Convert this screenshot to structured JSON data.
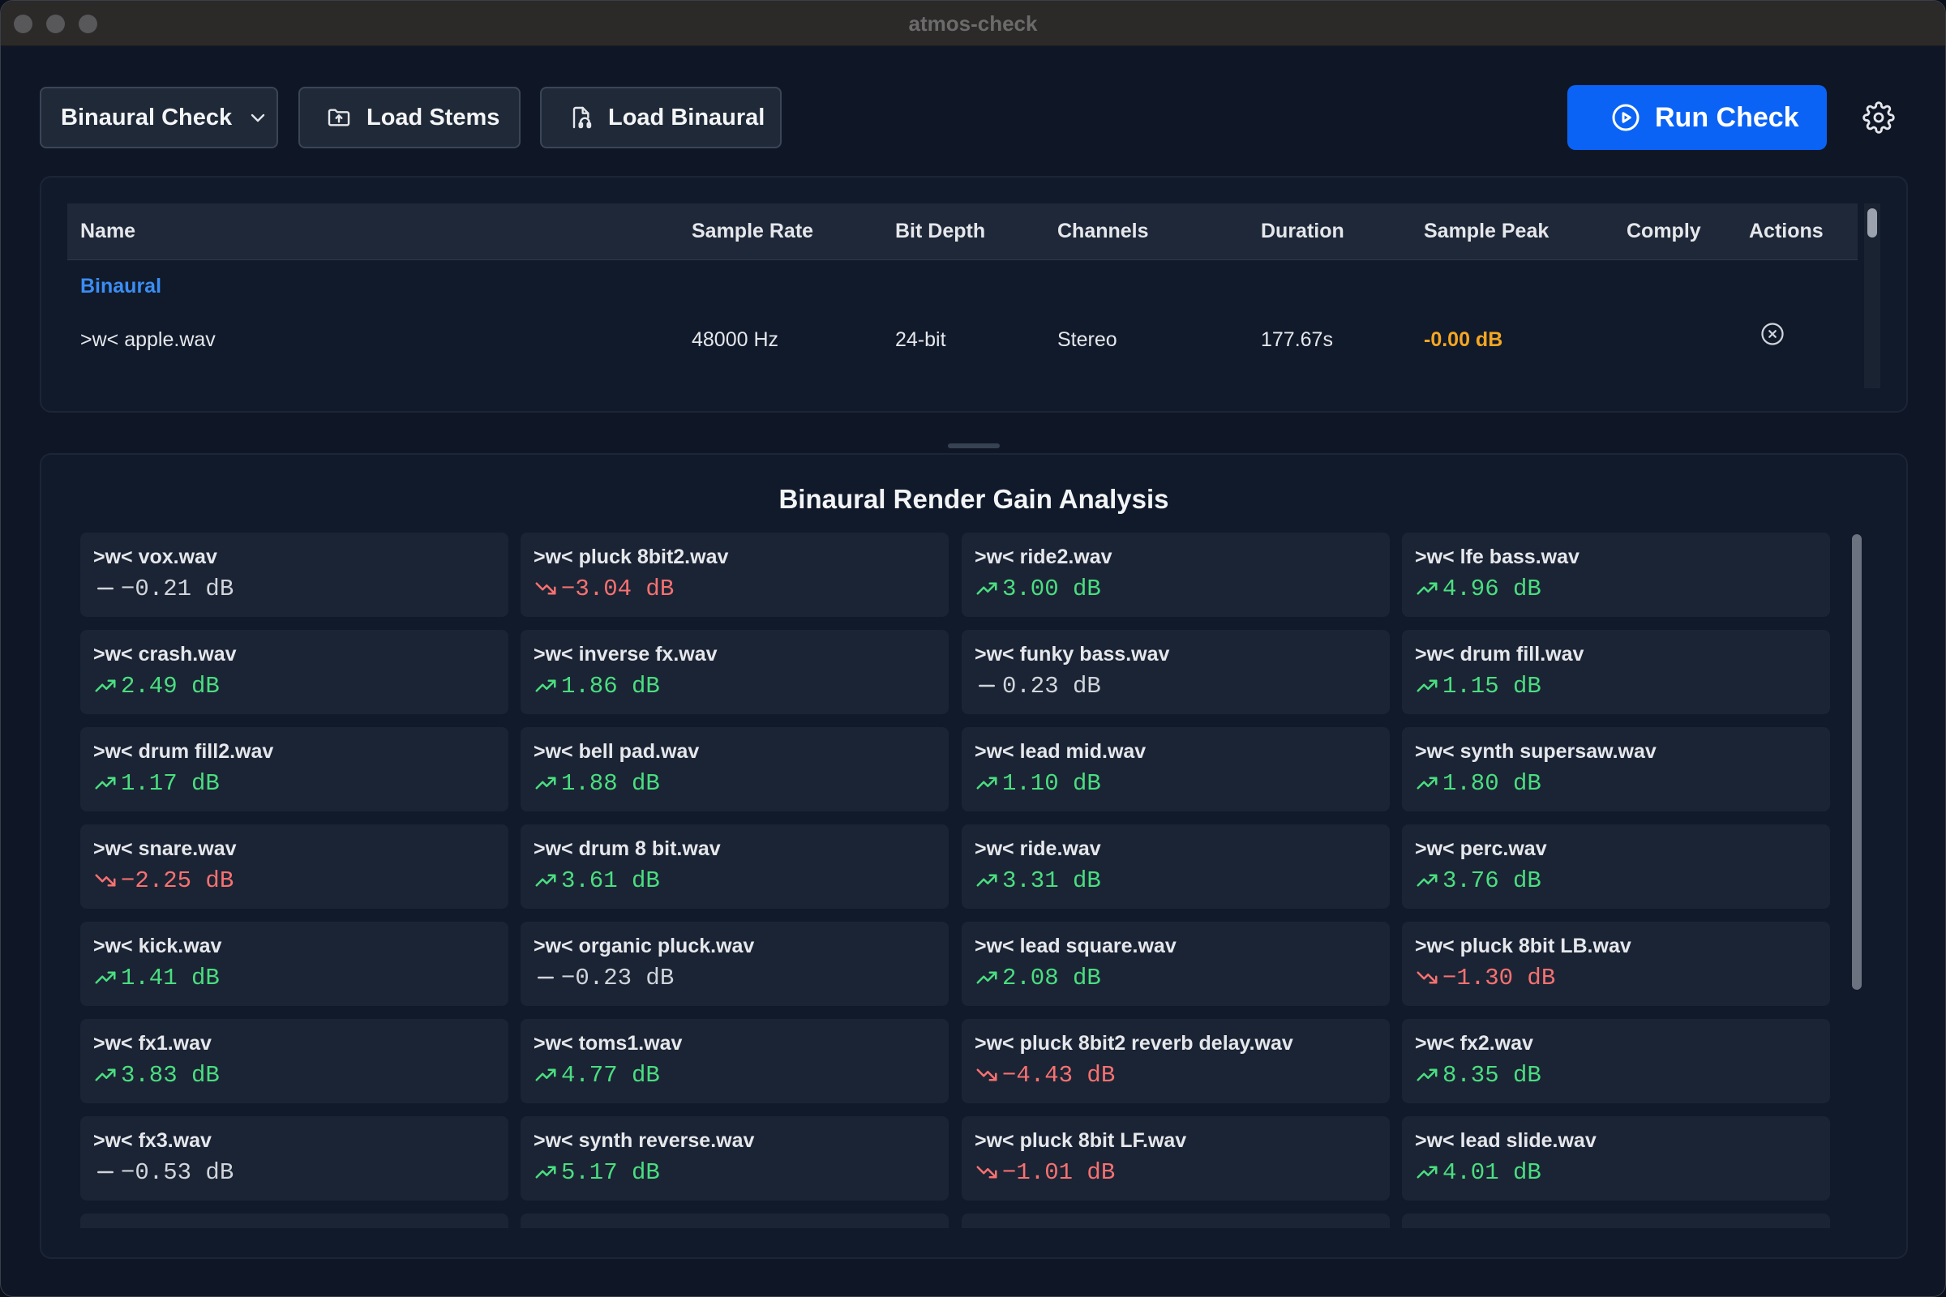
{
  "window": {
    "title": "atmos-check"
  },
  "toolbar": {
    "mode_label": "Binaural Check",
    "load_stems_label": "Load Stems",
    "load_binaural_label": "Load Binaural",
    "run_label": "Run Check",
    "run_color": "#0b63f5"
  },
  "files": {
    "headers": {
      "name": "Name",
      "sample_rate": "Sample Rate",
      "bit_depth": "Bit Depth",
      "channels": "Channels",
      "duration": "Duration",
      "sample_peak": "Sample Peak",
      "comply": "Comply",
      "actions": "Actions"
    },
    "group": "Binaural",
    "row": {
      "name": ">w< apple.wav",
      "sample_rate": "48000 Hz",
      "bit_depth": "24-bit",
      "channels": "Stereo",
      "duration": "177.67s",
      "sample_peak": "-0.00 dB",
      "comply": "",
      "action_icon": "close-circle-icon"
    }
  },
  "analysis": {
    "title": "Binaural Render Gain Analysis",
    "colors": {
      "up": "#4ade80",
      "down": "#f87171",
      "flat": "#d1d5db"
    },
    "items": [
      {
        "name": ">w< vox.wav",
        "value": "−0.21 dB",
        "trend": "flat"
      },
      {
        "name": ">w< pluck 8bit2.wav",
        "value": "−3.04 dB",
        "trend": "down"
      },
      {
        "name": ">w< ride2.wav",
        "value": "3.00 dB",
        "trend": "up"
      },
      {
        "name": ">w< lfe bass.wav",
        "value": "4.96 dB",
        "trend": "up"
      },
      {
        "name": ">w< crash.wav",
        "value": "2.49 dB",
        "trend": "up"
      },
      {
        "name": ">w< inverse fx.wav",
        "value": "1.86 dB",
        "trend": "up"
      },
      {
        "name": ">w< funky bass.wav",
        "value": "0.23 dB",
        "trend": "flat"
      },
      {
        "name": ">w< drum fill.wav",
        "value": "1.15 dB",
        "trend": "up"
      },
      {
        "name": ">w< drum fill2.wav",
        "value": "1.17 dB",
        "trend": "up"
      },
      {
        "name": ">w< bell pad.wav",
        "value": "1.88 dB",
        "trend": "up"
      },
      {
        "name": ">w< lead mid.wav",
        "value": "1.10 dB",
        "trend": "up"
      },
      {
        "name": ">w< synth supersaw.wav",
        "value": "1.80 dB",
        "trend": "up"
      },
      {
        "name": ">w< snare.wav",
        "value": "−2.25 dB",
        "trend": "down"
      },
      {
        "name": ">w< drum 8 bit.wav",
        "value": "3.61 dB",
        "trend": "up"
      },
      {
        "name": ">w< ride.wav",
        "value": "3.31 dB",
        "trend": "up"
      },
      {
        "name": ">w< perc.wav",
        "value": "3.76 dB",
        "trend": "up"
      },
      {
        "name": ">w< kick.wav",
        "value": "1.41 dB",
        "trend": "up"
      },
      {
        "name": ">w< organic pluck.wav",
        "value": "−0.23 dB",
        "trend": "flat"
      },
      {
        "name": ">w< lead square.wav",
        "value": "2.08 dB",
        "trend": "up"
      },
      {
        "name": ">w< pluck 8bit LB.wav",
        "value": "−1.30 dB",
        "trend": "down"
      },
      {
        "name": ">w< fx1.wav",
        "value": "3.83 dB",
        "trend": "up"
      },
      {
        "name": ">w< toms1.wav",
        "value": "4.77 dB",
        "trend": "up"
      },
      {
        "name": ">w< pluck 8bit2 reverb delay.wav",
        "value": "−4.43 dB",
        "trend": "down"
      },
      {
        "name": ">w< fx2.wav",
        "value": "8.35 dB",
        "trend": "up"
      },
      {
        "name": ">w< fx3.wav",
        "value": "−0.53 dB",
        "trend": "flat"
      },
      {
        "name": ">w< synth reverse.wav",
        "value": "5.17 dB",
        "trend": "up"
      },
      {
        "name": ">w< pluck 8bit LF.wav",
        "value": "−1.01 dB",
        "trend": "down"
      },
      {
        "name": ">w< lead slide.wav",
        "value": "4.01 dB",
        "trend": "up"
      }
    ]
  }
}
